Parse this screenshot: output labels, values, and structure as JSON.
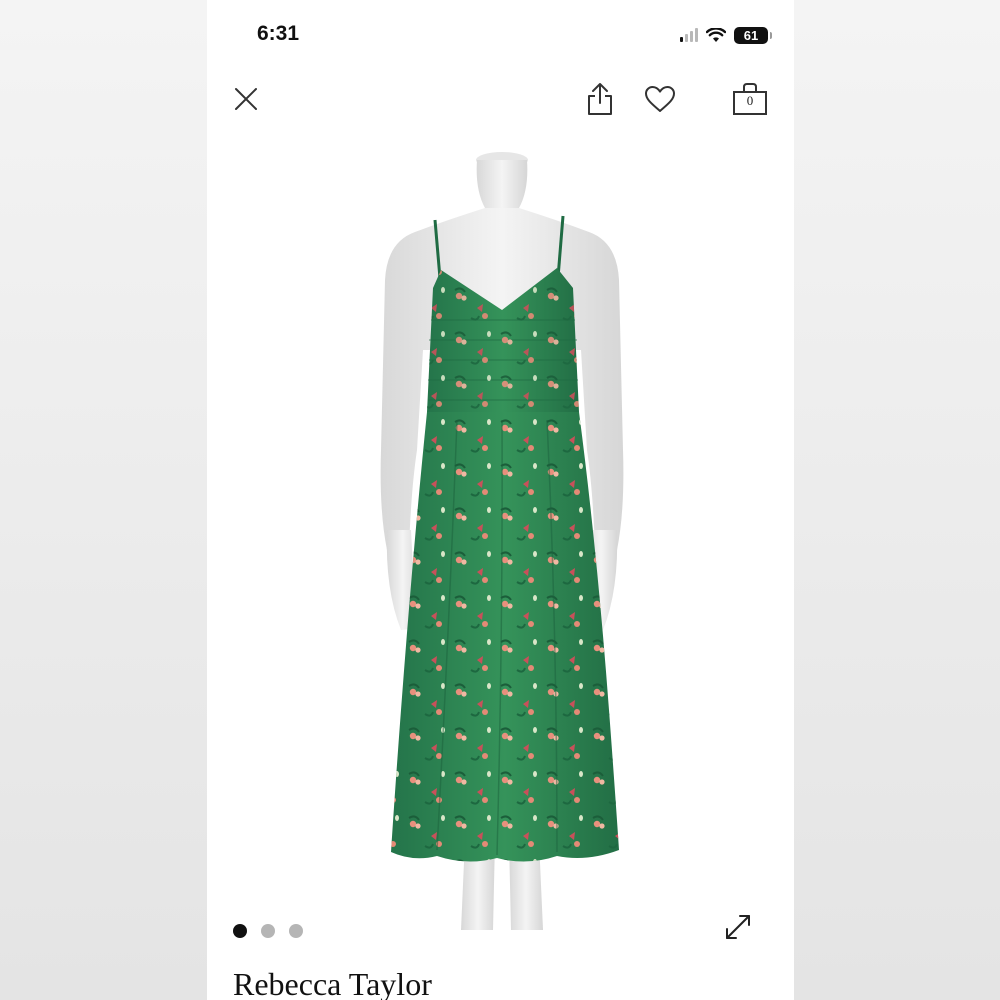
{
  "status_bar": {
    "time": "6:31",
    "battery": "61",
    "icons": [
      "cellular-signal-icon",
      "wifi-icon",
      "battery-icon"
    ]
  },
  "top_bar": {
    "icons": [
      "close-icon",
      "share-icon",
      "heart-icon",
      "shopping-bag-icon"
    ],
    "bag_count": "0"
  },
  "product": {
    "image_description_icon": "dress-on-mannequin",
    "dress_color": "#2f8a52",
    "print_color": "#e0806f",
    "brand": "Rebecca Taylor"
  },
  "carousel": {
    "total": 3,
    "active_index": 0,
    "expand_icon": "expand-arrows-icon"
  },
  "colors": {
    "background": "#ffffff",
    "text": "#111111",
    "inactive_dot": "#b5b5b5"
  }
}
